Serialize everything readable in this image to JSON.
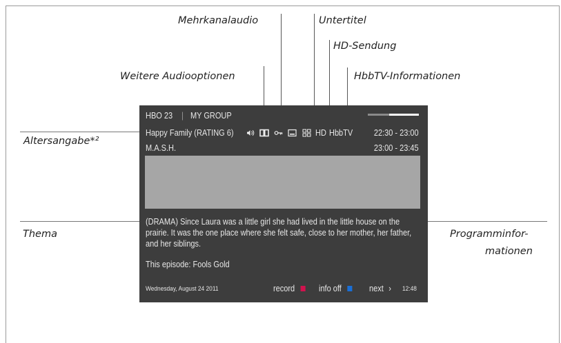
{
  "callouts": {
    "mehrkanal": "Mehrkanalaudio",
    "untertitel": "Untertitel",
    "hd": "HD-Sendung",
    "weitere": "Weitere Audiooptionen",
    "hbbtv": "HbbTV-Informationen",
    "alter": "Altersangabe*²",
    "thema": "Thema",
    "prog1": "Programminfor-",
    "prog2": "mationen"
  },
  "tv": {
    "channel": "HBO 23",
    "separator": "|",
    "group": "MY GROUP",
    "progress": 0.58,
    "current_title": "Happy Family (RATING 6)",
    "hd_badge": "HD",
    "hbbtv_badge": "HbbTV",
    "current_time": "22:30 - 23:00",
    "next_title": "M.A.S.H.",
    "next_time": "23:00 - 23:45",
    "description": "(DRAMA) Since Laura was a little girl she had lived in the little house on the prairie. It was the one place where she felt safe, close to her mother, her father, and her siblings.",
    "episode": "This episode: Fools Gold",
    "date": "Wednesday, August 24 2011",
    "record_label": "record",
    "info_label": "info off",
    "next_label": "next",
    "next_arrow": "›",
    "clock": "12:48",
    "colors": {
      "record": "#d2124e",
      "info": "#1a6fd6",
      "panel": "#3d3d3d"
    },
    "icons": [
      "audio-options-icon",
      "multichannel-audio-icon",
      "age-rating-key-icon",
      "subtitles-icon",
      "hbbtv-grid-icon"
    ]
  }
}
